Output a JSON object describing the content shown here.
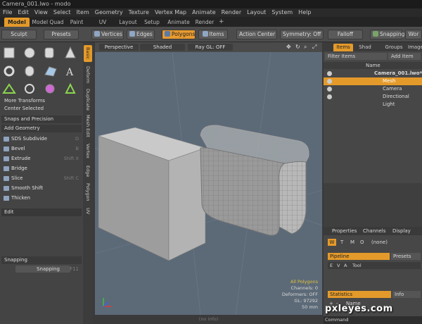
{
  "window": {
    "title": "Camera_001.lwo - modo"
  },
  "menu": [
    "File",
    "Edit",
    "View",
    "Select",
    "Item",
    "Geometry",
    "Texture",
    "Vertex Map",
    "Animate",
    "Render",
    "Layout",
    "System",
    "Help"
  ],
  "layout_tabs": [
    {
      "label": "Model",
      "active": true
    },
    {
      "label": "Model Quad",
      "active": false
    },
    {
      "label": "Paint",
      "active": false
    },
    {
      "label": "UV",
      "active": false
    },
    {
      "label": "Layout",
      "active": false
    },
    {
      "label": "Setup",
      "active": false
    },
    {
      "label": "Animate",
      "active": false
    },
    {
      "label": "Render",
      "active": false
    }
  ],
  "layout_tab_plus": "+",
  "toolbar": {
    "sculpt": "Sculpt",
    "presets": "Presets",
    "vertices": "Vertices",
    "edges": "Edges",
    "polygons": "Polygons",
    "items": "Items",
    "action_center": "Action Center",
    "symmetry": "Symmetry: Off",
    "falloff": "Falloff",
    "snapping": "Snapping",
    "work": "Wor"
  },
  "left": {
    "more_transforms": "More Transforms",
    "center_selected": "Center Selected",
    "snaps_precision": "Snaps and Precision",
    "add_geometry": "Add Geometry",
    "tools": [
      {
        "label": "SDS Subdivide",
        "shortcut": "D"
      },
      {
        "label": "Bevel",
        "shortcut": "B"
      },
      {
        "label": "Extrude",
        "shortcut": "Shift X"
      },
      {
        "label": "Bridge",
        "shortcut": ""
      },
      {
        "label": "Slice",
        "shortcut": "Shift C"
      },
      {
        "label": "Smooth Shift",
        "shortcut": ""
      },
      {
        "label": "Thicken",
        "shortcut": ""
      }
    ],
    "edit": "Edit",
    "snapping_header": "Snapping",
    "snapping_button": "Snapping",
    "snapping_key": "F11"
  },
  "vtabs": [
    "Basic",
    "Deform",
    "Duplicate",
    "Mesh Edit",
    "Vertex",
    "Edge",
    "Polygon",
    "UV"
  ],
  "viewport": {
    "perspective": "Perspective",
    "shaded": "Shaded",
    "raygl": "Ray GL: OFF",
    "stats": {
      "all_polygons": "All Polygons",
      "channels": "Channels: 0",
      "deformers": "Deformers: OFF",
      "gl": "GL: 97292",
      "distance": "50 mm"
    },
    "status": "(no info)"
  },
  "right": {
    "tabs": [
      "Items",
      "Shad",
      "Groups",
      "Images"
    ],
    "filter_items": "Filter Items",
    "add_item": "Add Item",
    "name_header": "Name",
    "items": [
      {
        "label": "Camera_001.lwo*",
        "level": 0
      },
      {
        "label": "Mesh",
        "level": 1,
        "selected": true
      },
      {
        "label": "Camera",
        "level": 1
      },
      {
        "label": "Directional Light",
        "level": 1
      }
    ],
    "prop_tabs": [
      "Properties",
      "Channels",
      "Display"
    ],
    "wtmq": [
      "W",
      "T",
      "M",
      "O"
    ],
    "none": "(none)",
    "pipeline": "Pipeline",
    "presets": "Presets",
    "cols": [
      "E",
      "V",
      "A",
      "Tool"
    ],
    "statistics": "Statistics",
    "info": "Info",
    "plus": "+",
    "minus": "-",
    "name_col": "Name",
    "command": "Command"
  },
  "watermark": "pxleyes.com",
  "colors": {
    "accent": "#e49a2a",
    "viewport_bg": "#5c6a78"
  }
}
